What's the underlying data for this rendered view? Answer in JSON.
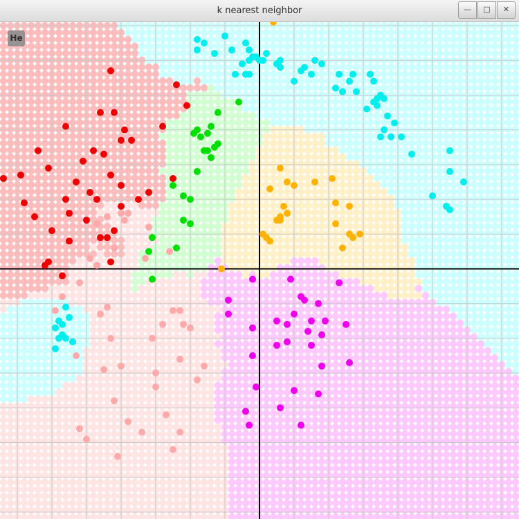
{
  "window": {
    "title": "k nearest neighbor",
    "controls": {
      "minimize_icon": "minimize-icon",
      "maximize_icon": "maximize-icon",
      "close_icon": "close-icon"
    }
  },
  "overlay_button": {
    "label": "He"
  },
  "colors": {
    "red": "#ee0000",
    "lightred": "#ffaaaa",
    "cyan": "#00eeee",
    "green": "#00e000",
    "orange": "#ffb300",
    "magenta": "#ee00ee",
    "grid": "#c8c8c8",
    "axis": "#000000"
  },
  "chart_data": {
    "type": "scatter",
    "title": "",
    "xlabel": "",
    "ylabel": "",
    "xlim": [
      -7.5,
      7.5
    ],
    "ylim": [
      -7.2,
      7.1
    ],
    "grid": true,
    "series": [
      {
        "color": "red",
        "points": [
          [
            -4.3,
            5.7
          ],
          [
            -2.4,
            5.3
          ],
          [
            -2.1,
            4.7
          ],
          [
            -4.6,
            4.5
          ],
          [
            -4.2,
            4.5
          ],
          [
            -5.6,
            4.1
          ],
          [
            -3.9,
            4.0
          ],
          [
            -2.8,
            4.1
          ],
          [
            -4.0,
            3.7
          ],
          [
            -3.7,
            3.7
          ],
          [
            -6.4,
            3.4
          ],
          [
            -4.8,
            3.4
          ],
          [
            -5.1,
            3.1
          ],
          [
            -6.9,
            2.7
          ],
          [
            -4.3,
            2.7
          ],
          [
            -5.3,
            2.5
          ],
          [
            -4.0,
            2.4
          ],
          [
            -4.9,
            2.2
          ],
          [
            -4.7,
            2.0
          ],
          [
            -3.5,
            2.0
          ],
          [
            -3.2,
            2.2
          ],
          [
            -2.5,
            2.6
          ],
          [
            -4.5,
            3.3
          ],
          [
            -6.1,
            2.9
          ],
          [
            -7.4,
            2.6
          ],
          [
            -6.8,
            1.9
          ],
          [
            -5.6,
            2.0
          ],
          [
            -4.0,
            1.8
          ],
          [
            -5.5,
            1.6
          ],
          [
            -6.5,
            1.5
          ],
          [
            -5.0,
            1.4
          ],
          [
            -6.0,
            1.1
          ],
          [
            -4.2,
            1.1
          ],
          [
            -4.6,
            0.9
          ],
          [
            -4.4,
            0.9
          ],
          [
            -5.5,
            0.8
          ],
          [
            -6.2,
            0.1
          ],
          [
            -6.1,
            0.2
          ],
          [
            -4.3,
            0.2
          ],
          [
            -5.7,
            -0.2
          ]
        ]
      },
      {
        "color": "lightred",
        "points": [
          [
            -4.0,
            1.6
          ],
          [
            -3.8,
            1.6
          ],
          [
            -3.9,
            1.4
          ],
          [
            -4.4,
            1.5
          ],
          [
            -4.7,
            1.3
          ],
          [
            -3.2,
            1.2
          ],
          [
            -4.9,
            0.3
          ],
          [
            -4.7,
            0.1
          ],
          [
            -4.2,
            0.6
          ],
          [
            -3.3,
            0.3
          ],
          [
            -2.6,
            0.5
          ],
          [
            -5.2,
            -0.4
          ],
          [
            -5.7,
            -0.8
          ],
          [
            -5.9,
            -1.2
          ],
          [
            -4.4,
            -1.1
          ],
          [
            -4.6,
            -1.3
          ],
          [
            -2.5,
            -1.2
          ],
          [
            -2.3,
            -1.2
          ],
          [
            -2.8,
            -1.6
          ],
          [
            -2.2,
            -1.6
          ],
          [
            -2.0,
            -1.7
          ],
          [
            -3.1,
            -2.0
          ],
          [
            -4.3,
            -2.0
          ],
          [
            -5.3,
            -2.5
          ],
          [
            -4.0,
            -2.8
          ],
          [
            -4.5,
            -2.9
          ],
          [
            -3.0,
            -3.4
          ],
          [
            -3.0,
            -3.0
          ],
          [
            -2.3,
            -2.6
          ],
          [
            -1.6,
            -2.8
          ],
          [
            -1.8,
            -3.2
          ],
          [
            -4.2,
            -3.8
          ],
          [
            -3.8,
            -4.4
          ],
          [
            -2.7,
            -4.2
          ],
          [
            -2.3,
            -4.7
          ],
          [
            -5.2,
            -4.6
          ],
          [
            -5.0,
            -4.9
          ],
          [
            -3.4,
            -4.7
          ],
          [
            -2.5,
            -5.2
          ],
          [
            -4.1,
            -5.4
          ]
        ]
      },
      {
        "color": "cyan",
        "points": [
          [
            -1.8,
            6.6
          ],
          [
            -1.6,
            6.5
          ],
          [
            -1.0,
            6.7
          ],
          [
            -1.3,
            6.2
          ],
          [
            -0.8,
            6.3
          ],
          [
            -0.4,
            6.5
          ],
          [
            -0.3,
            6.3
          ],
          [
            -0.2,
            6.1
          ],
          [
            -0.5,
            5.9
          ],
          [
            -0.3,
            5.6
          ],
          [
            0.0,
            6.0
          ],
          [
            0.1,
            6.0
          ],
          [
            0.2,
            6.2
          ],
          [
            0.6,
            6.0
          ],
          [
            0.5,
            5.9
          ],
          [
            0.6,
            5.8
          ],
          [
            1.3,
            5.8
          ],
          [
            1.5,
            5.6
          ],
          [
            2.3,
            5.6
          ],
          [
            2.6,
            5.4
          ],
          [
            2.7,
            5.6
          ],
          [
            3.2,
            5.6
          ],
          [
            3.3,
            5.4
          ],
          [
            2.8,
            5.1
          ],
          [
            3.5,
            5.0
          ],
          [
            3.4,
            4.9
          ],
          [
            3.6,
            4.9
          ],
          [
            3.3,
            4.8
          ],
          [
            2.2,
            5.2
          ],
          [
            2.4,
            5.1
          ],
          [
            1.6,
            6.0
          ],
          [
            1.8,
            5.9
          ],
          [
            1.2,
            5.7
          ],
          [
            1.0,
            5.4
          ],
          [
            3.1,
            4.6
          ],
          [
            3.4,
            4.7
          ],
          [
            3.7,
            4.4
          ],
          [
            3.9,
            4.2
          ],
          [
            3.6,
            4.0
          ],
          [
            3.8,
            3.8
          ],
          [
            3.5,
            3.8
          ],
          [
            4.1,
            3.8
          ],
          [
            5.5,
            3.4
          ],
          [
            4.4,
            3.3
          ],
          [
            5.5,
            2.8
          ],
          [
            5.9,
            2.5
          ],
          [
            5.0,
            2.1
          ],
          [
            5.4,
            1.8
          ],
          [
            5.5,
            1.7
          ],
          [
            -0.1,
            6.1
          ],
          [
            -5.6,
            -1.1
          ],
          [
            -5.8,
            -1.5
          ],
          [
            -5.5,
            -1.4
          ],
          [
            -5.7,
            -1.6
          ],
          [
            -5.6,
            -2.0
          ],
          [
            -5.9,
            -1.7
          ],
          [
            -5.7,
            -1.9
          ],
          [
            -5.4,
            -2.1
          ],
          [
            -5.9,
            -2.3
          ],
          [
            -5.8,
            -2.0
          ],
          [
            -1.8,
            6.3
          ],
          [
            -0.7,
            5.6
          ],
          [
            -0.4,
            5.6
          ],
          [
            -0.3,
            6.0
          ]
        ]
      },
      {
        "color": "green",
        "points": [
          [
            -0.6,
            4.8
          ],
          [
            -1.2,
            4.5
          ],
          [
            -1.4,
            4.1
          ],
          [
            -1.8,
            4.0
          ],
          [
            -1.9,
            3.9
          ],
          [
            -1.5,
            3.9
          ],
          [
            -1.7,
            3.8
          ],
          [
            -1.2,
            3.6
          ],
          [
            -1.3,
            3.5
          ],
          [
            -1.5,
            3.4
          ],
          [
            -1.6,
            3.4
          ],
          [
            -1.4,
            3.2
          ],
          [
            -1.8,
            2.8
          ],
          [
            -2.5,
            2.4
          ],
          [
            -2.2,
            2.1
          ],
          [
            -2.0,
            2.0
          ],
          [
            -2.2,
            1.4
          ],
          [
            -2.0,
            1.3
          ],
          [
            -3.1,
            0.9
          ],
          [
            -2.4,
            0.6
          ],
          [
            -3.2,
            0.5
          ],
          [
            -3.1,
            -0.3
          ]
        ]
      },
      {
        "color": "orange",
        "points": [
          [
            0.4,
            7.1
          ],
          [
            0.6,
            2.9
          ],
          [
            0.8,
            2.5
          ],
          [
            1.0,
            2.4
          ],
          [
            0.3,
            2.3
          ],
          [
            1.6,
            2.5
          ],
          [
            2.1,
            2.6
          ],
          [
            0.7,
            1.8
          ],
          [
            2.2,
            1.9
          ],
          [
            2.6,
            1.8
          ],
          [
            0.6,
            1.5
          ],
          [
            0.8,
            1.6
          ],
          [
            0.6,
            1.4
          ],
          [
            0.5,
            1.4
          ],
          [
            2.2,
            1.3
          ],
          [
            0.1,
            1.0
          ],
          [
            0.2,
            0.9
          ],
          [
            0.3,
            0.8
          ],
          [
            2.6,
            1.0
          ],
          [
            2.7,
            0.9
          ],
          [
            2.9,
            1.0
          ],
          [
            2.4,
            0.6
          ],
          [
            -1.1,
            0.0
          ]
        ]
      },
      {
        "color": "magenta",
        "points": [
          [
            -0.2,
            -0.3
          ],
          [
            0.9,
            -0.3
          ],
          [
            2.3,
            -0.4
          ],
          [
            1.2,
            -0.8
          ],
          [
            1.3,
            -0.9
          ],
          [
            1.7,
            -1.0
          ],
          [
            -0.9,
            -0.9
          ],
          [
            -0.9,
            -1.3
          ],
          [
            1.0,
            -1.3
          ],
          [
            1.5,
            -1.5
          ],
          [
            0.5,
            -1.5
          ],
          [
            0.8,
            -1.6
          ],
          [
            1.4,
            -1.8
          ],
          [
            1.9,
            -1.5
          ],
          [
            -0.2,
            -1.7
          ],
          [
            2.5,
            -1.6
          ],
          [
            1.8,
            -1.9
          ],
          [
            0.8,
            -2.1
          ],
          [
            0.5,
            -2.2
          ],
          [
            1.5,
            -2.2
          ],
          [
            -0.2,
            -2.5
          ],
          [
            1.8,
            -2.8
          ],
          [
            2.6,
            -2.7
          ],
          [
            -0.1,
            -3.4
          ],
          [
            1.0,
            -3.5
          ],
          [
            1.7,
            -3.6
          ],
          [
            -0.4,
            -4.1
          ],
          [
            0.6,
            -4.0
          ],
          [
            -0.3,
            -4.5
          ],
          [
            1.2,
            -4.5
          ]
        ]
      }
    ]
  }
}
